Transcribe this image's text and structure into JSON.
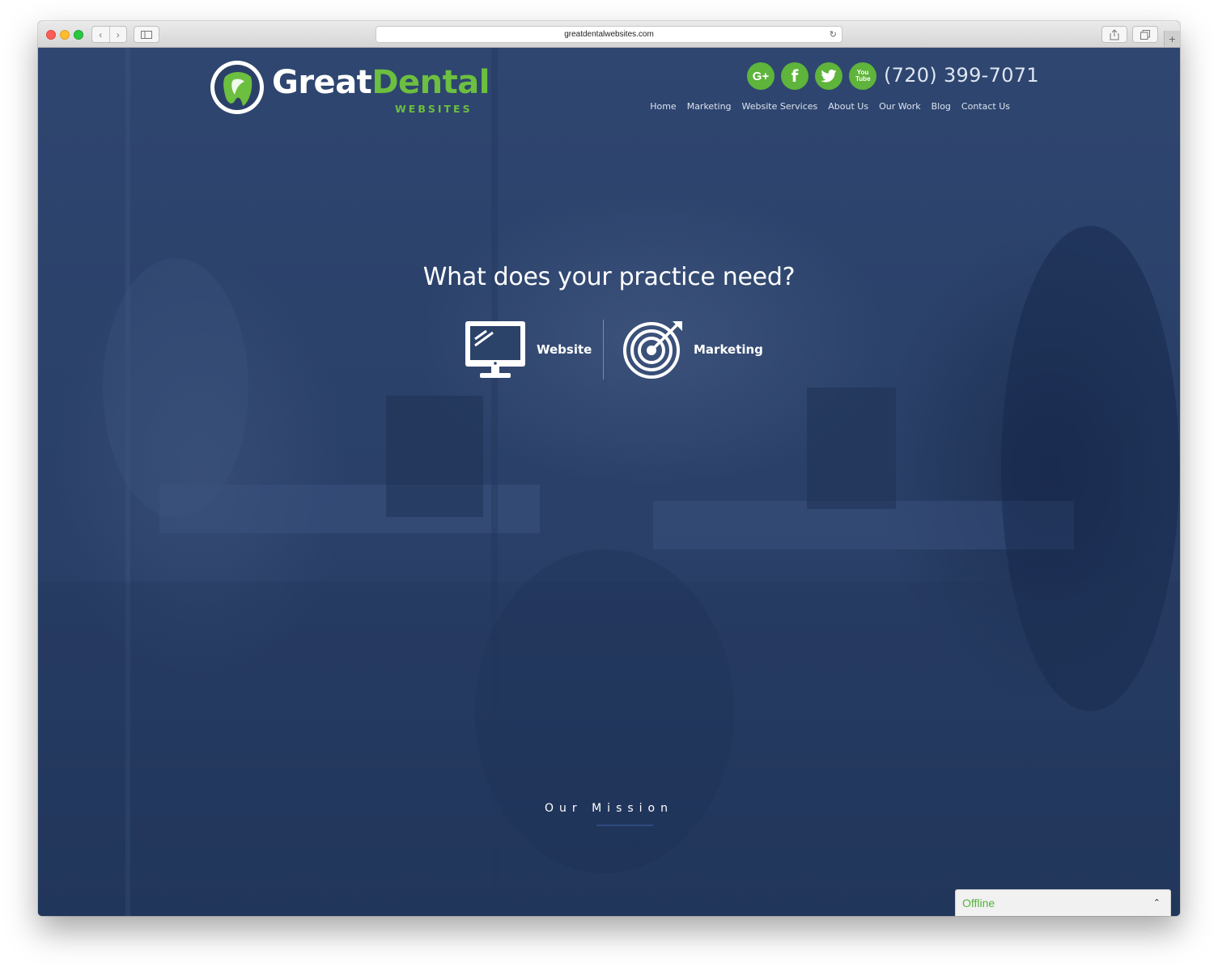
{
  "browser": {
    "url": "greatdentalwebsites.com",
    "icons": {
      "back": "chevron-left-icon",
      "forward": "chevron-right-icon",
      "sidebar": "sidebar-icon",
      "reload": "reload-icon",
      "share": "share-icon",
      "tabs": "tabs-icon",
      "new_tab": "plus-icon"
    }
  },
  "logo": {
    "word1": "Great",
    "word2": "Dental",
    "sub": "WEBSITES"
  },
  "header": {
    "phone": "(720) 399-7071",
    "social": [
      {
        "name": "google-plus",
        "glyph": "G+"
      },
      {
        "name": "facebook",
        "glyph": "f"
      },
      {
        "name": "twitter",
        "glyph": "t"
      },
      {
        "name": "youtube",
        "glyph": "You Tube"
      }
    ],
    "nav": [
      "Home",
      "Marketing",
      "Website Services",
      "About Us",
      "Our Work",
      "Blog",
      "Contact Us"
    ]
  },
  "hero": {
    "title": "What does your practice need?",
    "options": [
      {
        "label": "Website",
        "icon": "monitor-icon"
      },
      {
        "label": "Marketing",
        "icon": "target-icon"
      }
    ]
  },
  "mission": {
    "label": "Our Mission"
  },
  "chat": {
    "status": "Offline",
    "toggle_icon": "chevron-up-icon"
  },
  "colors": {
    "brand_green": "#6cbf3f",
    "social_green": "#5fb43b",
    "overlay_navy": "#2a4068"
  }
}
